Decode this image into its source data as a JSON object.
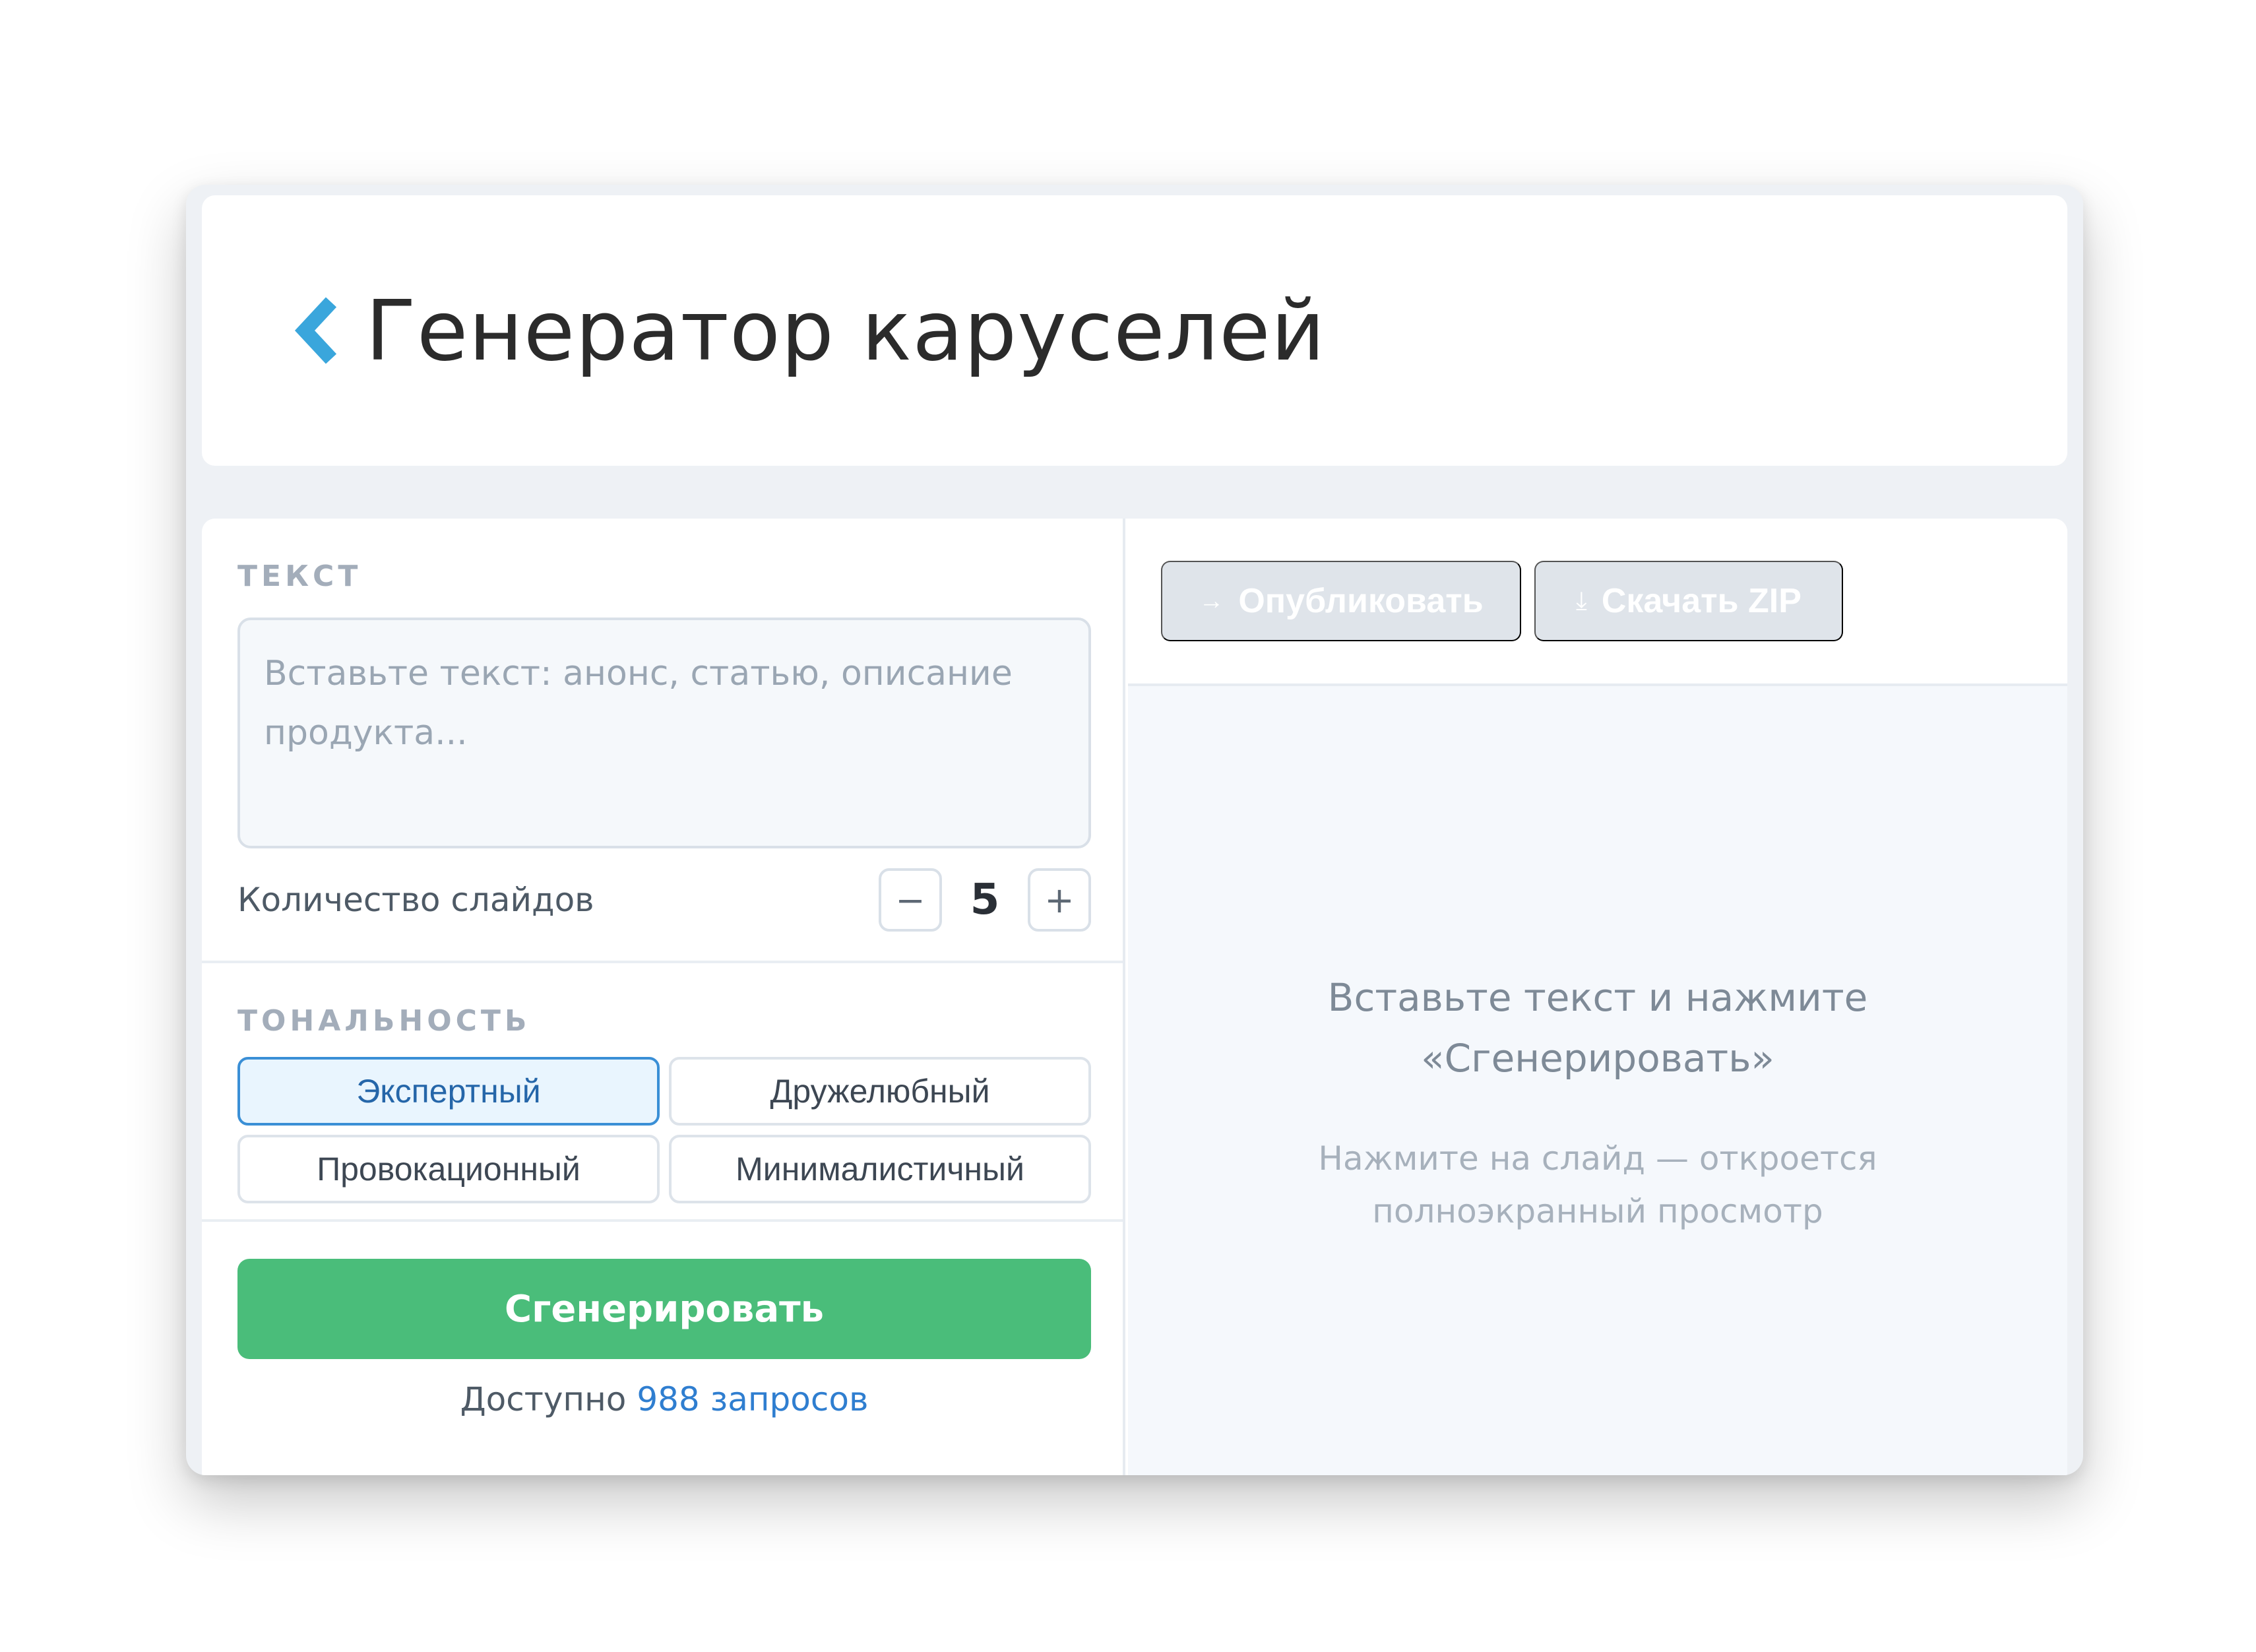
{
  "header": {
    "title": "Генератор каруселей",
    "back_icon": "chevron-left-icon"
  },
  "form": {
    "text_label": "ТЕКСТ",
    "text_placeholder": "Вставьте текст: анонс, статью, описание продукта...",
    "text_value": "",
    "slides_label": "Количество слайдов",
    "slides_minus": "−",
    "slides_value": "5",
    "slides_plus": "+",
    "tone_label": "ТОНАЛЬНОСТЬ",
    "tones": [
      "Экспертный",
      "Дружелюбный",
      "Провокационный",
      "Минималистичный"
    ],
    "selected_tone": "Экспертный",
    "generate_label": "Сгенерировать",
    "quota_prefix": "Доступно",
    "quota_count": "988 запросов"
  },
  "preview": {
    "publish_label": "Опубликовать",
    "publish_icon": "→",
    "zip_label": "Скачать ZIP",
    "zip_icon": "⤓",
    "empty_line1": "Вставьте текст и нажмите",
    "empty_line2": "«Сгенерировать»",
    "hint_line1": "Нажмите на слайд — откроется",
    "hint_line2": "полноэкранный просмотр"
  },
  "colors": {
    "accent_blue": "#3aa6dc",
    "generate_green": "#4abd7a",
    "link_blue": "#2f7ed0",
    "active_tone_border": "#3a8fd6",
    "disabled_button": "#dfe4ea"
  }
}
